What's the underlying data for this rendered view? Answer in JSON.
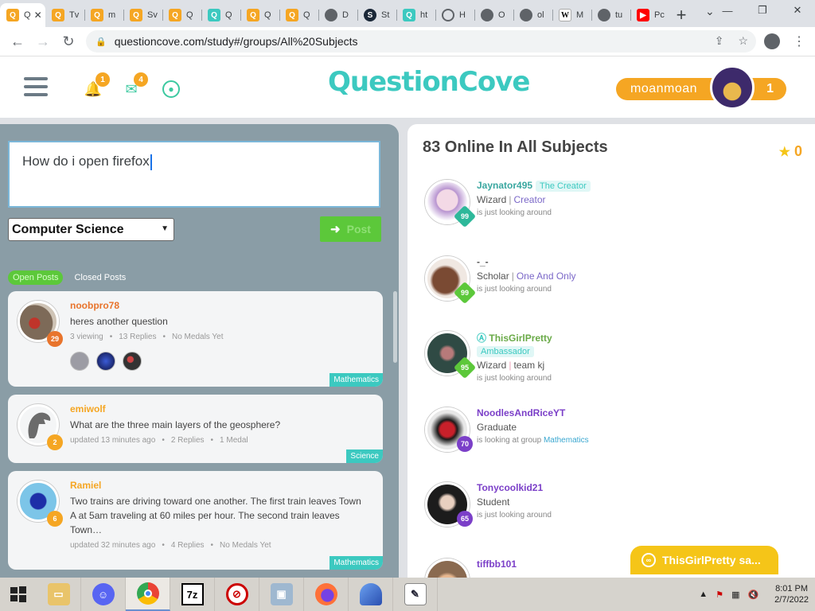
{
  "browser": {
    "tabs": [
      {
        "label": "Q",
        "icon": "questioncove",
        "active": true
      },
      {
        "label": "Tv",
        "icon": "questioncove"
      },
      {
        "label": "m",
        "icon": "questioncove"
      },
      {
        "label": "Sv",
        "icon": "questioncove"
      },
      {
        "label": "Q",
        "icon": "questioncove"
      },
      {
        "label": "Q",
        "icon": "questioncove-teal"
      },
      {
        "label": "Q",
        "icon": "questioncove"
      },
      {
        "label": "Q",
        "icon": "questioncove"
      },
      {
        "label": "D",
        "icon": "globe"
      },
      {
        "label": "St",
        "icon": "steam"
      },
      {
        "label": "ht",
        "icon": "questioncove-teal"
      },
      {
        "label": "H",
        "icon": "history"
      },
      {
        "label": "O",
        "icon": "globe"
      },
      {
        "label": "ol",
        "icon": "globe"
      },
      {
        "label": "M",
        "icon": "wikipedia"
      },
      {
        "label": "tu",
        "icon": "globe"
      },
      {
        "label": "Pc",
        "icon": "youtube"
      }
    ],
    "new_tab_label": "+",
    "url": "questioncove.com/study#/groups/All%20Subjects"
  },
  "header": {
    "notifications_count": "1",
    "messages_count": "4",
    "logo_text": "QuestionCove",
    "username": "moanmoan",
    "user_medals": "1"
  },
  "compose": {
    "question_value": "How do i open firefox",
    "subject_selected": "Computer Science",
    "post_label": "Post"
  },
  "post_tabs": {
    "open": "Open Posts",
    "closed": "Closed Posts"
  },
  "posts": [
    {
      "user": "noobpro78",
      "user_color": "#e8742c",
      "rank": "29",
      "rank_color": "#e8742c",
      "question": "heres another question",
      "meta": [
        "3 viewing",
        "13 Replies",
        "No Medals Yet"
      ],
      "subject": "Mathematics"
    },
    {
      "user": "emiwolf",
      "user_color": "#f5a623",
      "rank": "2",
      "rank_color": "#f5a623",
      "question": "What are the three main layers of the geosphere?",
      "meta": [
        "updated 13 minutes ago",
        "2 Replies",
        "1 Medal"
      ],
      "subject": "Science"
    },
    {
      "user": "Ramiel",
      "user_color": "#f5a623",
      "rank": "6",
      "rank_color": "#f5a623",
      "question": "Two trains are driving toward one another. The first train leaves Town A at 5am traveling at 60 miles per hour. The second train leaves Town…",
      "meta": [
        "updated 32 minutes ago",
        "4 Replies",
        "No Medals Yet"
      ],
      "subject": "Mathematics"
    }
  ],
  "online": {
    "title": "83 Online In All Subjects",
    "score": "0",
    "members": [
      {
        "name": "Jaynator495",
        "name_color": "#3aa7a0",
        "tag": "The Creator",
        "role": "Wizard",
        "role2": "Creator",
        "role2_color": "#7b68c8",
        "status": "is just looking around",
        "rank": "99",
        "rank_color": "#2db89a"
      },
      {
        "name": "-_-",
        "name_color": "#555",
        "tag": "",
        "role": "Scholar",
        "role2": "One And Only",
        "role2_color": "#7b68c8",
        "status": "is just looking around",
        "rank": "99",
        "rank_color": "#5cc83a"
      },
      {
        "name": "ThisGirlPretty",
        "name_color": "#6aaa48",
        "tag": "Ambassador",
        "role": "Wizard",
        "role2": "team kj",
        "role2_color": "#f0a0b8",
        "status": "is just looking around",
        "rank": "95",
        "rank_color": "#5cc83a"
      },
      {
        "name": "NoodlesAndRiceYT",
        "name_color": "#7b3fc8",
        "tag": "",
        "role": "Graduate",
        "role2": "",
        "role2_color": "",
        "status": "is looking at group",
        "status_link": "Mathematics",
        "rank": "70",
        "rank_color": "#7b3fc8"
      },
      {
        "name": "Tonycoolkid21",
        "name_color": "#7b3fc8",
        "tag": "",
        "role": "Student",
        "role2": "",
        "role2_color": "",
        "status": "is just looking around",
        "rank": "65",
        "rank_color": "#7b3fc8"
      },
      {
        "name": "tiffbb101",
        "name_color": "#7b3fc8",
        "tag": "",
        "role": "",
        "role2": "",
        "role2_color": "",
        "status": "",
        "rank": "",
        "rank_color": ""
      }
    ]
  },
  "chat_popup": "ThisGirlPretty sa...",
  "taskbar": {
    "time": "8:01 PM",
    "date": "2/7/2022"
  }
}
